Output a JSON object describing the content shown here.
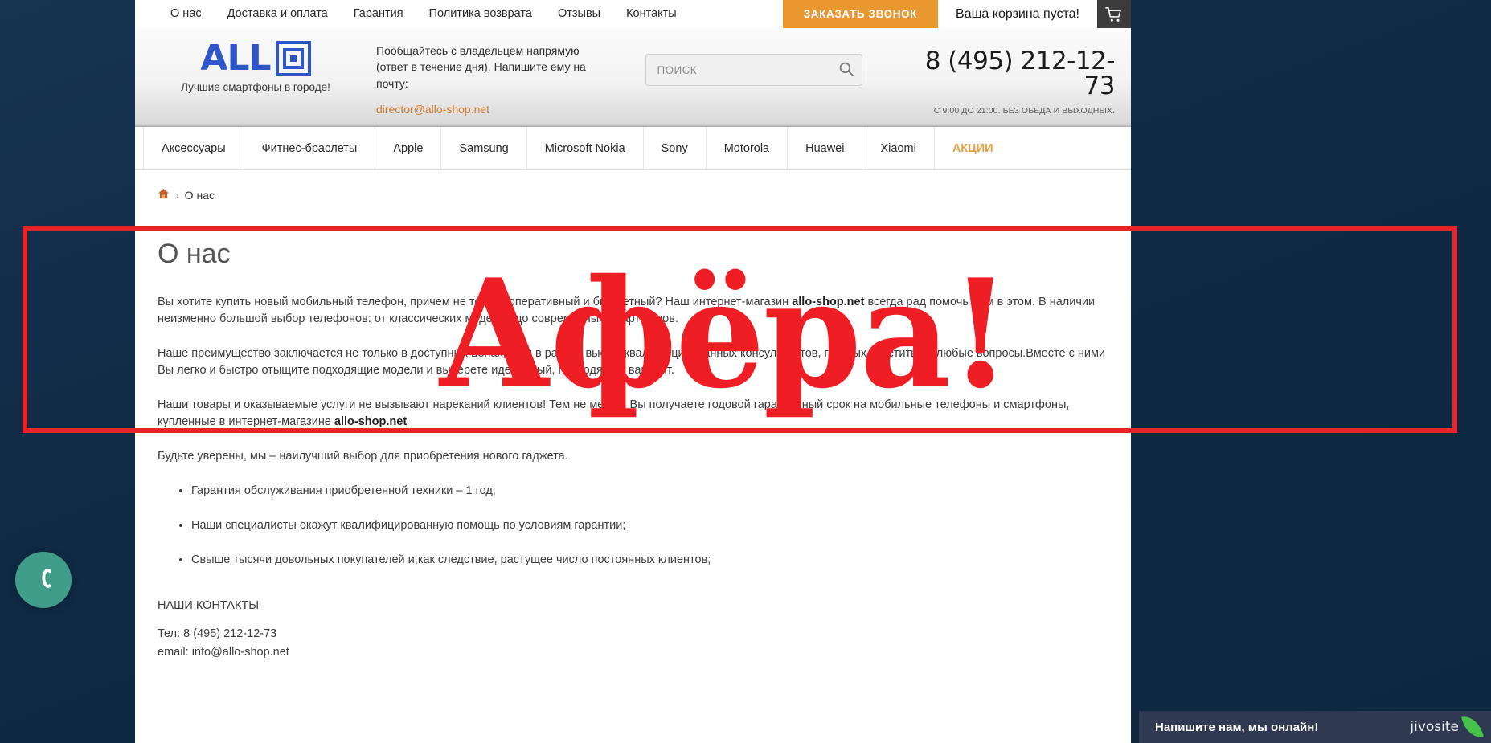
{
  "topbar": {
    "nav": [
      {
        "label": "О нас"
      },
      {
        "label": "Доставка и оплата"
      },
      {
        "label": "Гарантия"
      },
      {
        "label": "Политика возврата"
      },
      {
        "label": "Отзывы"
      },
      {
        "label": "Контакты"
      }
    ],
    "callback_label": "ЗАКАЗАТЬ ЗВОНОК",
    "cart_text": "Ваша корзина пуста!",
    "cart_icon": "shopping-cart-icon",
    "callback_color": "#e9972f",
    "cart_button_color": "#3c3c3c"
  },
  "header": {
    "logo_word": "ALL",
    "logo_mark": "concentric-square-icon",
    "tagline": "Лучшие смартфоны в городе!",
    "owner_text": "Пообщайтесь с владельцем напрямую (ответ в течение дня). Напишите ему на почту:",
    "owner_email": "director@allo-shop.net",
    "search_placeholder": "ПОИСК",
    "search_value": "",
    "search_icon": "search-icon",
    "phone": "8 (495) 212-12-73",
    "hours": "С 9:00 ДО 21:00. БЕЗ ОБЕДА И ВЫХОДНЫХ.",
    "logo_color": "#2f56c8",
    "email_color": "#d07a2a"
  },
  "catnav": {
    "items": [
      {
        "label": "Аксессуары",
        "promo": false
      },
      {
        "label": "Фитнес-браслеты",
        "promo": false
      },
      {
        "label": "Apple",
        "promo": false
      },
      {
        "label": "Samsung",
        "promo": false
      },
      {
        "label": "Microsoft Nokia",
        "promo": false
      },
      {
        "label": "Sony",
        "promo": false
      },
      {
        "label": "Motorola",
        "promo": false
      },
      {
        "label": "Huawei",
        "promo": false
      },
      {
        "label": "Xiaomi",
        "promo": false
      },
      {
        "label": "АКЦИИ",
        "promo": true
      }
    ],
    "promo_color": "#e2a33c"
  },
  "breadcrumb": {
    "home_icon": "home-icon",
    "separator": "›",
    "current": "О нас"
  },
  "article": {
    "title": "О нас",
    "paragraphs": [
      {
        "pre": "Вы хотите купить новый мобильный телефон, причем не только оперативный и бюджетный? Наш интернет-магазин ",
        "bold": "allo-shop.net",
        "post": " всегда рад помочь Вам в этом. В наличии неизменно большой выбор телефонов: от классических моделей до современных смартфонов."
      },
      {
        "pre": "Наше преимущество заключается не только в доступных ценах, но и в работе высококвалифицированных консультантов, готовых ответить на любые вопросы.Вместе с ними Вы легко и быстро отыщите подходящие модели и выберете идеальный, подходящий вариант.",
        "bold": "",
        "post": ""
      },
      {
        "pre": "Наши товары и оказываемые услуги не вызывают нареканий клиентов! Тем не менее, Вы получаете годовой гарантийный срок на мобильные телефоны и смартфоны, купленные в интернет-магазине ",
        "bold": "allo-shop.net",
        "post": ""
      }
    ],
    "lead": "Будьте уверены, мы – наилучший выбор для приобретения нового гаджета.",
    "bullets": [
      "Гарантия обслуживания приобретенной техники – 1 год;",
      "Наши специалисты окажут квалифицированную помощь по условиям гарантии;",
      "Свыше тысячи довольных покупателей и,как следствие, растущее число постоянных клиентов;"
    ],
    "contacts_title": "НАШИ КОНТАКТЫ",
    "contacts_phone": "Тел: 8 (495) 212-12-73",
    "contacts_email": "email: info@allo-shop.net"
  },
  "annotation": {
    "stamp_text": "Афёра!",
    "stamp_color": "#ef1d24",
    "box_color": "#e8232a"
  },
  "widgets": {
    "call_fab_icon": "phone-handset-icon",
    "call_fab_color": "#3f9d89",
    "chat_message": "Напишите нам, мы онлайн!",
    "chat_brand": "jivosite",
    "chat_bar_color": "#2f3a52",
    "chat_leaf_color": "#46c24a"
  }
}
